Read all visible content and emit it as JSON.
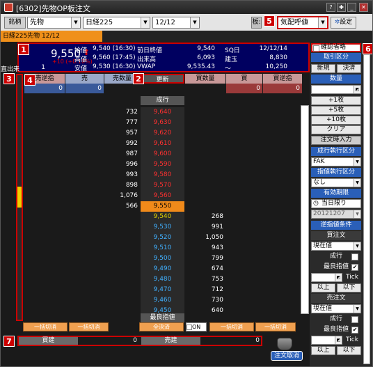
{
  "window": {
    "title": "[6302]先物OP板注文"
  },
  "toolbar": {
    "brand_label": "銘柄",
    "type_value": "先物",
    "index_value": "日経225",
    "month_value": "12/12",
    "board_label": "板:",
    "board_mode_value": "気配呼値",
    "settings_label": "設定"
  },
  "symbol_bar": {
    "name": "日経225先物 12/12"
  },
  "quote": {
    "price": "9,550",
    "change": "+10 (+0.10%)",
    "volume_label": "直出来",
    "volume_value": "1",
    "rows": [
      {
        "l1": "始値",
        "v1": "9,540 (16:30)",
        "l2": "前日終値",
        "v2": "9,540",
        "l3": "SQ日",
        "v3": "12/12/14"
      },
      {
        "l1": "高値",
        "v1": "9,560 (17:45)",
        "l2": "出来高",
        "v2": "6,093",
        "l3": "建玉",
        "v3": "8,830"
      },
      {
        "l1": "安値",
        "v1": "9,530 (16:30)",
        "l2": "VWAP",
        "v2": "9,535.43",
        "l3": "〜",
        "v3": "10,250"
      }
    ]
  },
  "book": {
    "headers": {
      "sell_limit": "売逆指",
      "sell": "売",
      "sell_qty": "売数量",
      "update": "更新",
      "buy_qty": "買数量",
      "buy": "買",
      "buy_limit": "買逆指"
    },
    "head_values": {
      "sell_limit": "0",
      "sell": "0",
      "buy": "0",
      "buy_limit": "0"
    },
    "market_label": "成行",
    "best_label": "最良指値",
    "rows": [
      {
        "sq": "732",
        "p": "9,640",
        "bq": ""
      },
      {
        "sq": "777",
        "p": "9,630",
        "bq": ""
      },
      {
        "sq": "957",
        "p": "9,620",
        "bq": ""
      },
      {
        "sq": "992",
        "p": "9,610",
        "bq": ""
      },
      {
        "sq": "987",
        "p": "9,600",
        "bq": ""
      },
      {
        "sq": "996",
        "p": "9,590",
        "bq": ""
      },
      {
        "sq": "993",
        "p": "9,580",
        "bq": ""
      },
      {
        "sq": "898",
        "p": "9,570",
        "bq": ""
      },
      {
        "sq": "1,076",
        "p": "9,560",
        "bq": ""
      },
      {
        "sq": "566",
        "p": "9,550",
        "bq": ""
      },
      {
        "sq": "",
        "p": "9,540",
        "bq": "268"
      },
      {
        "sq": "",
        "p": "9,530",
        "bq": "991"
      },
      {
        "sq": "",
        "p": "9,520",
        "bq": "1,050"
      },
      {
        "sq": "",
        "p": "9,510",
        "bq": "943"
      },
      {
        "sq": "",
        "p": "9,500",
        "bq": "799"
      },
      {
        "sq": "",
        "p": "9,490",
        "bq": "674"
      },
      {
        "sq": "",
        "p": "9,480",
        "bq": "753"
      },
      {
        "sq": "",
        "p": "9,470",
        "bq": "712"
      },
      {
        "sq": "",
        "p": "9,460",
        "bq": "730"
      },
      {
        "sq": "",
        "p": "9,450",
        "bq": "640"
      }
    ]
  },
  "bottom": {
    "bulk1": "一括切消",
    "bulk2": "一括切消",
    "collect": "全決済",
    "on_label": "ON",
    "bulk3": "一括切消",
    "bulk4": "一括切消"
  },
  "totals": {
    "buy_label": "買建",
    "buy_value": "0",
    "sell_label": "売建",
    "sell_value": "0"
  },
  "right_panel": {
    "skip_confirm": "確認省略",
    "trade_type": "取引区分",
    "new": "新規",
    "close": "決済",
    "quantity": "数量",
    "plus1": "+1枚",
    "plus5": "+5枚",
    "plus10": "+10枚",
    "clear": "クリア",
    "order_input": "注文時入力",
    "market_exec": "成行執行区分",
    "market_exec_value": "FAK",
    "limit_exec": "指値執行区分",
    "limit_exec_value": "なし",
    "expiry": "有効期限",
    "today_only": "当日限り",
    "date_value": "20121207",
    "stop_cond": "逆指値条件",
    "buy_order": "買注文",
    "buy_price_value": "現在値",
    "market": "成行",
    "best_limit": "最良指値",
    "tick": "Tick",
    "above": "以上",
    "below": "以下",
    "sell_order": "売注文",
    "sell_price_value": "現在値",
    "market2": "成行",
    "best_limit2": "最良指値",
    "tick2": "Tick",
    "above2": "以上",
    "below2": "以下",
    "cancel_order": "注文取消"
  },
  "markers": {
    "m1": "1",
    "m2": "2",
    "m3": "3",
    "m4": "4",
    "m5": "5",
    "m6": "6",
    "m7": "7"
  }
}
